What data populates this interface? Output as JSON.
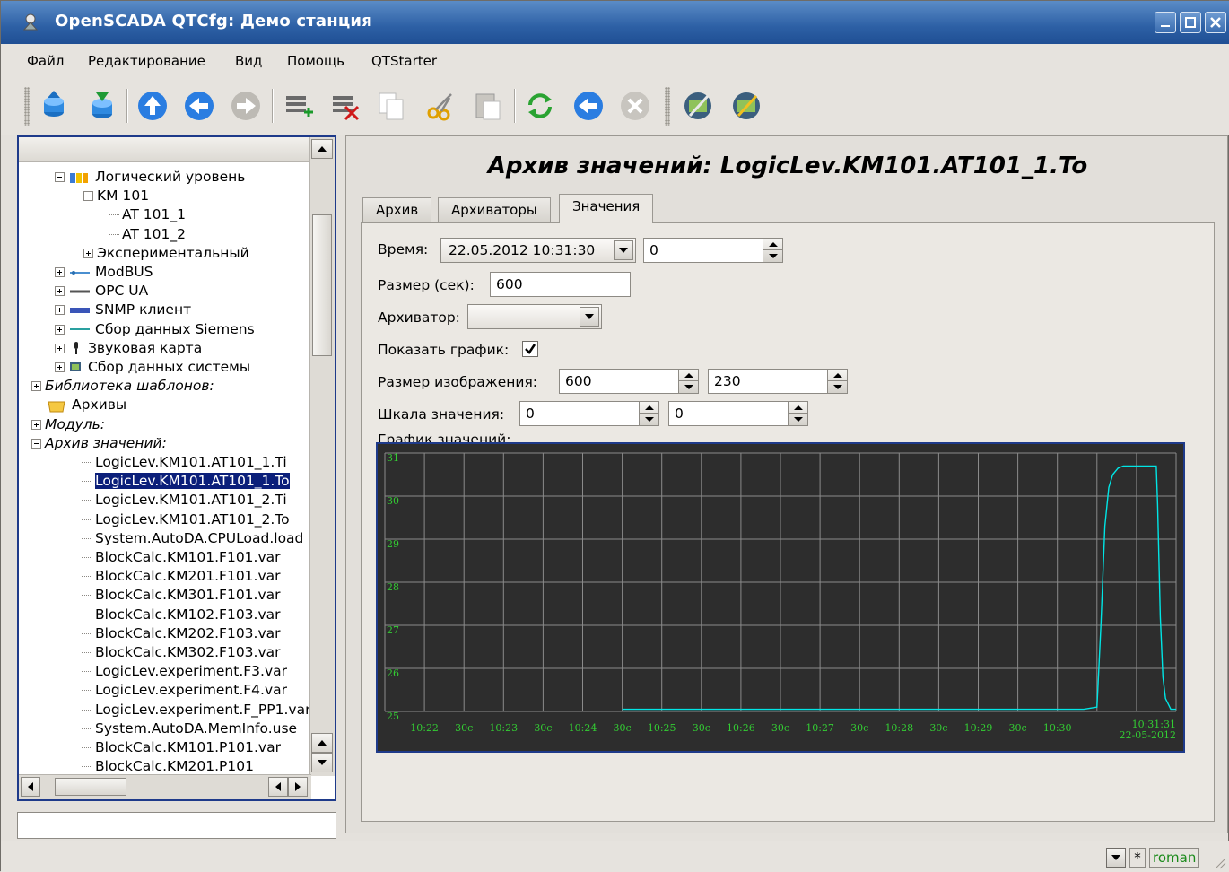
{
  "window": {
    "title": "OpenSCADA QTCfg: Демо станция"
  },
  "menu": [
    "Файл",
    "Редактирование",
    "Вид",
    "Помощь",
    "QTStarter"
  ],
  "toolbar": {
    "icons": [
      "db-load-icon",
      "db-save-icon",
      "up-icon",
      "back-icon",
      "forward-icon",
      "add-item-icon",
      "delete-item-icon",
      "copy-icon",
      "cut-icon",
      "paste-icon",
      "refresh-icon",
      "start-icon",
      "stop-icon",
      "station-icon",
      "station-config-icon"
    ]
  },
  "tree": {
    "items": [
      {
        "label": "Логический уровень",
        "italic": false
      },
      {
        "label": "KM 101",
        "italic": false
      },
      {
        "label": "AT 101_1",
        "italic": false
      },
      {
        "label": "AT 101_2",
        "italic": false
      },
      {
        "label": "Экспериментальный",
        "italic": false
      },
      {
        "label": "ModBUS",
        "italic": false
      },
      {
        "label": "OPC UA",
        "italic": false
      },
      {
        "label": "SNMP клиент",
        "italic": false
      },
      {
        "label": "Сбор данных Siemens",
        "italic": false
      },
      {
        "label": "Звуковая карта",
        "italic": false
      },
      {
        "label": "Сбор данных системы",
        "italic": false
      },
      {
        "label": "Библиотека шаблонов:",
        "italic": true
      },
      {
        "label": "Архивы",
        "italic": false
      },
      {
        "label": "Модуль:",
        "italic": true
      },
      {
        "label": "Архив значений:",
        "italic": true
      },
      {
        "label": "LogicLev.KM101.AT101_1.Ti",
        "italic": false
      },
      {
        "label": "LogicLev.KM101.AT101_1.To",
        "italic": false
      },
      {
        "label": "LogicLev.KM101.AT101_2.Ti",
        "italic": false
      },
      {
        "label": "LogicLev.KM101.AT101_2.To",
        "italic": false
      },
      {
        "label": "System.AutoDA.CPULoad.load",
        "italic": false
      },
      {
        "label": "BlockCalc.KM101.F101.var",
        "italic": false
      },
      {
        "label": "BlockCalc.KM201.F101.var",
        "italic": false
      },
      {
        "label": "BlockCalc.KM301.F101.var",
        "italic": false
      },
      {
        "label": "BlockCalc.KM102.F103.var",
        "italic": false
      },
      {
        "label": "BlockCalc.KM202.F103.var",
        "italic": false
      },
      {
        "label": "BlockCalc.KM302.F103.var",
        "italic": false
      },
      {
        "label": "LogicLev.experiment.F3.var",
        "italic": false
      },
      {
        "label": "LogicLev.experiment.F4.var",
        "italic": false
      },
      {
        "label": "LogicLev.experiment.F_PP1.var",
        "italic": false
      },
      {
        "label": "System.AutoDA.MemInfo.use",
        "italic": false
      },
      {
        "label": "BlockCalc.KM101.P101.var",
        "italic": false
      },
      {
        "label": "BlockCalc.KM201.P101",
        "italic": false
      }
    ],
    "selected_index": 16
  },
  "main": {
    "title": "Архив значений: LogicLev.KM101.AT101_1.To",
    "tabs": [
      "Архив",
      "Архиваторы",
      "Значения"
    ],
    "active_tab": "Значения",
    "form": {
      "time_label": "Время:",
      "time_value": "22.05.2012 10:31:30",
      "time_usec": "0",
      "size_label": "Размер (сек):",
      "size_value": "600",
      "archiver_label": "Архиватор:",
      "archiver_value": "",
      "show_graph_label": "Показать график:",
      "show_graph_checked": true,
      "img_size_label": "Размер изображения:",
      "img_width": "600",
      "img_height": "230",
      "scale_label": "Шкала значения:",
      "scale_min": "0",
      "scale_max": "0",
      "graph_label": "График значений:"
    }
  },
  "chart_data": {
    "type": "line",
    "background": "#2d2d2d",
    "line_color": "#00e5e5",
    "tick_color": "#33cc33",
    "y_ticks": [
      "31",
      "30",
      "29",
      "28",
      "27",
      "26",
      "25"
    ],
    "ylim": [
      25,
      31
    ],
    "x_ticks": [
      "10:22",
      "30c",
      "10:23",
      "30c",
      "10:24",
      "30c",
      "10:25",
      "30c",
      "10:26",
      "30c",
      "10:27",
      "30c",
      "10:28",
      "30c",
      "10:29",
      "30c",
      "10:30"
    ],
    "x_end_time": "10:31:31",
    "x_end_date": "22-05-2012",
    "xlim_sec": [
      0,
      600
    ],
    "x_sec": [
      180,
      200,
      250,
      300,
      350,
      400,
      450,
      500,
      530,
      540,
      543,
      546,
      549,
      552,
      556,
      560,
      570,
      580,
      585,
      586,
      588,
      590,
      592,
      596,
      600
    ],
    "y": [
      25.05,
      25.05,
      25.05,
      25.05,
      25.05,
      25.05,
      25.05,
      25.05,
      25.05,
      25.1,
      27.0,
      29.3,
      30.2,
      30.5,
      30.65,
      30.7,
      30.7,
      30.7,
      30.7,
      29.8,
      27.2,
      25.8,
      25.3,
      25.05,
      25.05
    ]
  },
  "status": {
    "user": "roman",
    "modified_flag": "*"
  }
}
